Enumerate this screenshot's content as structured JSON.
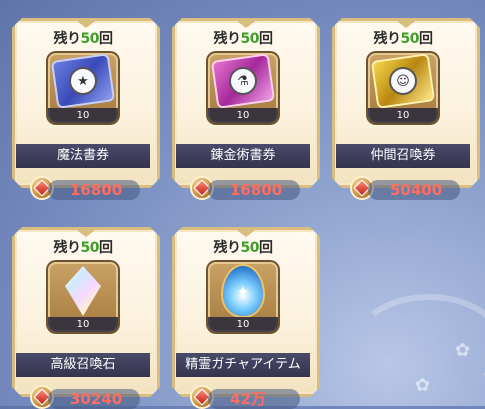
{
  "items": [
    {
      "remaining_prefix": "残り",
      "remaining_count": "50",
      "remaining_suffix": "回",
      "quantity": "10",
      "name": "魔法書券",
      "price": "16800",
      "icon": "blue-magic-ticket-icon",
      "emblem": "★"
    },
    {
      "remaining_prefix": "残り",
      "remaining_count": "50",
      "remaining_suffix": "回",
      "quantity": "10",
      "name": "錬金術書券",
      "price": "16800",
      "icon": "pink-alchemy-ticket-icon",
      "emblem": "⚗"
    },
    {
      "remaining_prefix": "残り",
      "remaining_count": "50",
      "remaining_suffix": "回",
      "quantity": "10",
      "name": "仲間召喚券",
      "price": "50400",
      "icon": "gold-ally-summon-ticket-icon",
      "emblem": "☺"
    },
    {
      "remaining_prefix": "残り",
      "remaining_count": "50",
      "remaining_suffix": "回",
      "quantity": "10",
      "name": "高級召喚石",
      "price": "30240",
      "icon": "summon-crystal-icon"
    },
    {
      "remaining_prefix": "残り",
      "remaining_count": "50",
      "remaining_suffix": "回",
      "quantity": "10",
      "name": "精霊ガチャアイテム",
      "price": "42万",
      "icon": "spirit-egg-icon",
      "emblem": "✦"
    }
  ],
  "colors": {
    "count_green": "#3f9e2a",
    "price_red": "#ff6d62",
    "frame_gold": "#d9bd7f"
  }
}
